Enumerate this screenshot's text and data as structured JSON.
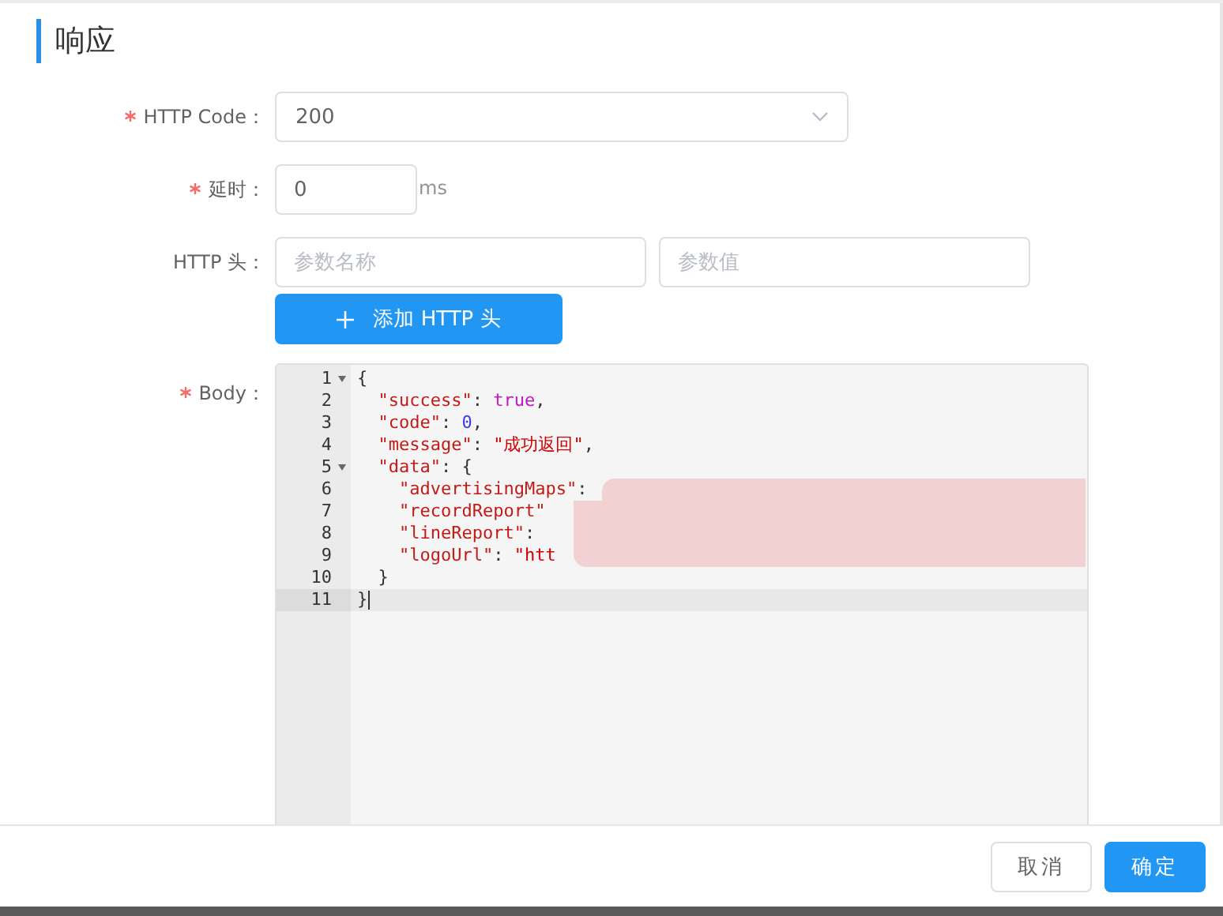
{
  "section_title": "响应",
  "fields": [
    {
      "kind": "select",
      "label": "HTTP Code：",
      "required": true,
      "value": "200"
    },
    {
      "kind": "delay",
      "label": "延时：",
      "required": true,
      "value": "0",
      "unit": "ms"
    },
    {
      "kind": "headers",
      "label": "HTTP 头：",
      "required": false,
      "name_placeholder": "参数名称",
      "value_placeholder": "参数值",
      "add_button": "添加 HTTP 头"
    },
    {
      "kind": "code",
      "label": "Body：",
      "required": true
    }
  ],
  "code_lines": [
    {
      "number": "1",
      "foldable": true,
      "selected": false,
      "tokens": [
        {
          "kind": "punct",
          "text": "{"
        }
      ]
    },
    {
      "number": "2",
      "foldable": false,
      "selected": false,
      "tokens": [
        {
          "kind": "key",
          "text": "  \"success\""
        },
        {
          "kind": "punct",
          "text": ": "
        },
        {
          "kind": "bool",
          "text": "true"
        },
        {
          "kind": "punct",
          "text": ","
        }
      ]
    },
    {
      "number": "3",
      "foldable": false,
      "selected": false,
      "tokens": [
        {
          "kind": "key",
          "text": "  \"code\""
        },
        {
          "kind": "punct",
          "text": ": "
        },
        {
          "kind": "num",
          "text": "0"
        },
        {
          "kind": "punct",
          "text": ","
        }
      ]
    },
    {
      "number": "4",
      "foldable": false,
      "selected": false,
      "tokens": [
        {
          "kind": "key",
          "text": "  \"message\""
        },
        {
          "kind": "punct",
          "text": ": "
        },
        {
          "kind": "str",
          "text": "\"成功返回\""
        },
        {
          "kind": "punct",
          "text": ","
        }
      ]
    },
    {
      "number": "5",
      "foldable": true,
      "selected": false,
      "tokens": [
        {
          "kind": "key",
          "text": "  \"data\""
        },
        {
          "kind": "punct",
          "text": ": {"
        }
      ]
    },
    {
      "number": "6",
      "foldable": false,
      "selected": false,
      "tokens": [
        {
          "kind": "key",
          "text": "    \"advertisingMaps\""
        },
        {
          "kind": "punct",
          "text": ":"
        }
      ]
    },
    {
      "number": "7",
      "foldable": false,
      "selected": false,
      "tokens": [
        {
          "kind": "key",
          "text": "    \"recordReport\""
        }
      ]
    },
    {
      "number": "8",
      "foldable": false,
      "selected": false,
      "tokens": [
        {
          "kind": "key",
          "text": "    \"lineReport\""
        },
        {
          "kind": "punct",
          "text": ":"
        }
      ]
    },
    {
      "number": "9",
      "foldable": false,
      "selected": false,
      "tokens": [
        {
          "kind": "key",
          "text": "    \"logoUrl\""
        },
        {
          "kind": "punct",
          "text": ": "
        },
        {
          "kind": "str",
          "text": "\"htt"
        }
      ]
    },
    {
      "number": "10",
      "foldable": false,
      "selected": false,
      "tokens": [
        {
          "kind": "punct",
          "text": "  }"
        }
      ]
    },
    {
      "number": "11",
      "foldable": false,
      "selected": true,
      "tokens": [
        {
          "kind": "punct",
          "text": "}"
        }
      ]
    }
  ],
  "footer_buttons": [
    {
      "label": "取消",
      "primary": false
    },
    {
      "label": "确定",
      "primary": true
    }
  ]
}
